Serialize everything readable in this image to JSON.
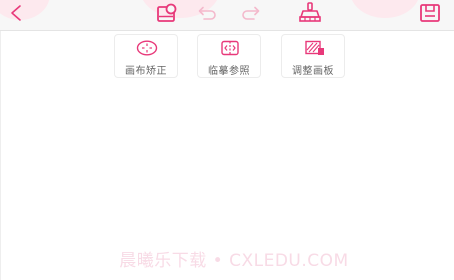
{
  "toolbar": {
    "back_icon": "chevron-left-icon",
    "reference_icon": "reference-image-icon",
    "undo_icon": "undo-icon",
    "redo_icon": "redo-icon",
    "clear_icon": "broom-icon",
    "save_icon": "save-icon"
  },
  "tools": [
    {
      "label": "画布矫正",
      "icon": "crosshair-circle-icon"
    },
    {
      "label": "临摹参照",
      "icon": "mirror-compare-icon"
    },
    {
      "label": "调整画板",
      "icon": "adjust-canvas-icon"
    }
  ],
  "watermark": "晨曦乐下载 • CXLEDU.COM",
  "colors": {
    "accent": "#e8397a",
    "disabled": "#f4b9cc",
    "blob": "#fde9ee"
  }
}
